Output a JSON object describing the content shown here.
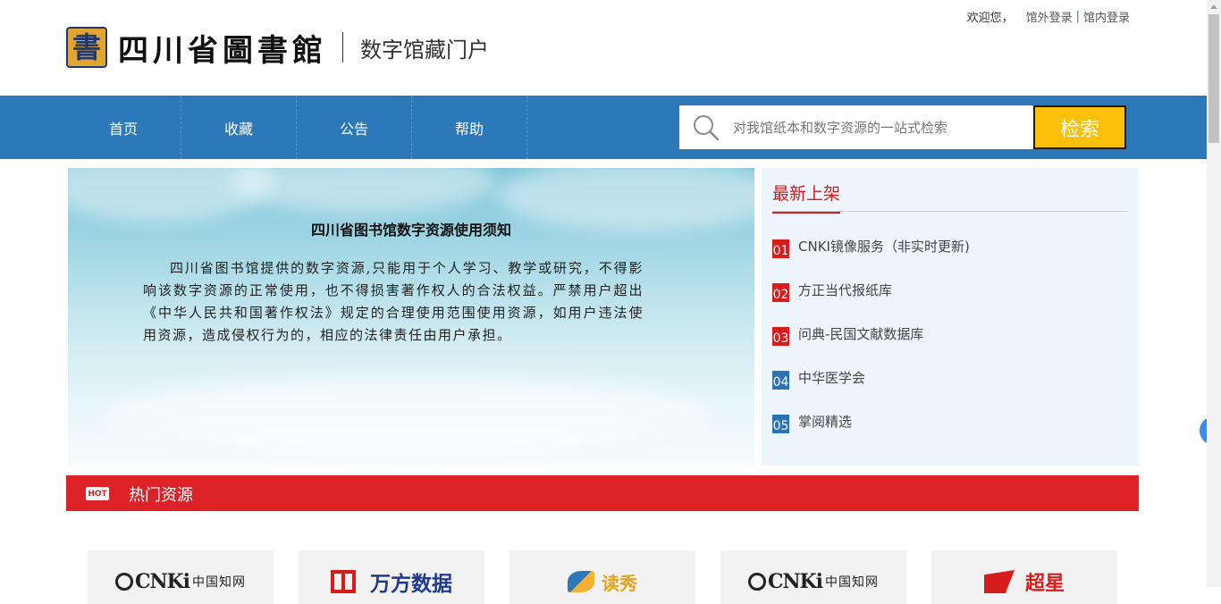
{
  "header": {
    "logo_seal_char": "書",
    "library_name": "四川省圖書館",
    "portal_name": "数字馆藏门户",
    "welcome": "欢迎您，",
    "login_external": "馆外登录",
    "login_separator": "|",
    "login_internal": "馆内登录"
  },
  "nav": {
    "items": [
      {
        "label": "首页"
      },
      {
        "label": "收藏"
      },
      {
        "label": "公告"
      },
      {
        "label": "帮助"
      }
    ],
    "search_placeholder": "对我馆纸本和数字资源的一站式检索",
    "search_button": "检索"
  },
  "notice": {
    "title": "四川省图书馆数字资源使用须知",
    "body": "四川省图书馆提供的数字资源,只能用于个人学习、教学或研究，不得影响该数字资源的正常使用，也不得损害著作权人的合法权益。严禁用户超出《中华人民共和国著作权法》规定的合理使用范围使用资源，如用户违法使用资源，造成侵权行为的，相应的法律责任由用户承担。"
  },
  "newest": {
    "title": "最新上架",
    "items": [
      {
        "num": "01",
        "color": "red",
        "text": "CNKI镜像服务（非实时更新)"
      },
      {
        "num": "02",
        "color": "red",
        "text": "方正当代报纸库"
      },
      {
        "num": "03",
        "color": "red",
        "text": "问典-民国文献数据库"
      },
      {
        "num": "04",
        "color": "blue",
        "text": "中华医学会"
      },
      {
        "num": "05",
        "color": "blue",
        "text": "掌阅精选"
      }
    ]
  },
  "hot": {
    "badge": "HOT",
    "title": "热门资源"
  },
  "cards": {
    "cnki_1": {
      "latin": "CNKi",
      "zh": "中国知网"
    },
    "wanfang": {
      "zh": "万方数据"
    },
    "duxiu": {
      "zh": "读秀"
    },
    "cnki_2": {
      "latin": "CNKi",
      "zh": "中国知网"
    },
    "guomi": {
      "zh": "超星"
    }
  },
  "side_tab": {
    "icon": "‹"
  },
  "colors": {
    "nav_blue": "#2d78b8",
    "search_button": "#fcc00b",
    "hot_red": "#dc2227",
    "title_red": "#cc1f1f"
  }
}
